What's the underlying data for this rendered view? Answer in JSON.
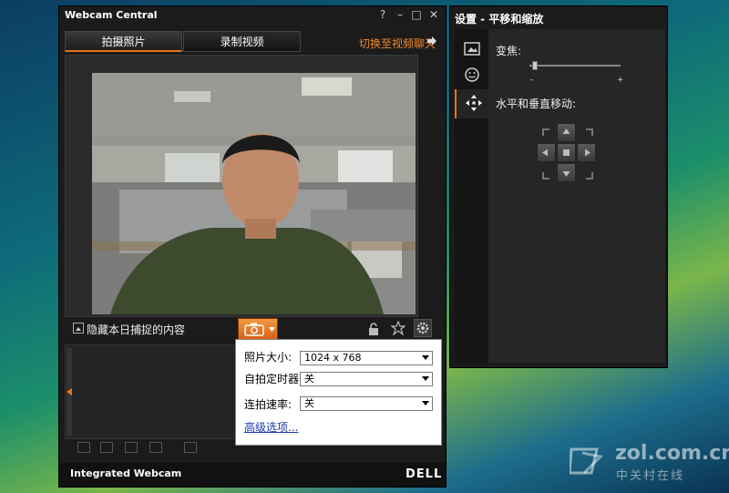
{
  "main_window": {
    "title": "Webcam Central",
    "controls": [
      "?",
      "–",
      "□",
      "✕"
    ],
    "tabs": [
      {
        "label": "拍摄照片",
        "active": true
      },
      {
        "label": "录制视频",
        "active": false
      }
    ],
    "switch_link": "切换至视频聊天",
    "hide_captured_label": "隐藏本日捕捉的内容",
    "status_title": "Integrated Webcam",
    "brand": "DELL",
    "accent_color": "#e8751a"
  },
  "capture_popup": {
    "rows": [
      {
        "label": "照片大小:",
        "value": "1024 x 768"
      },
      {
        "label": "自拍定时器:",
        "value": "关"
      },
      {
        "label": "连拍速率:",
        "value": "关"
      }
    ],
    "advanced_link": "高级选项..."
  },
  "settings_window": {
    "title": "设置 - 平移和缩放",
    "zoom_label": "变焦:",
    "zoom_min": "–",
    "zoom_max": "+",
    "zoom_level": 0.03,
    "pan_label": "水平和垂直移动:"
  },
  "watermark": {
    "text": "zol.com.cn",
    "sub": "中关村在线"
  }
}
